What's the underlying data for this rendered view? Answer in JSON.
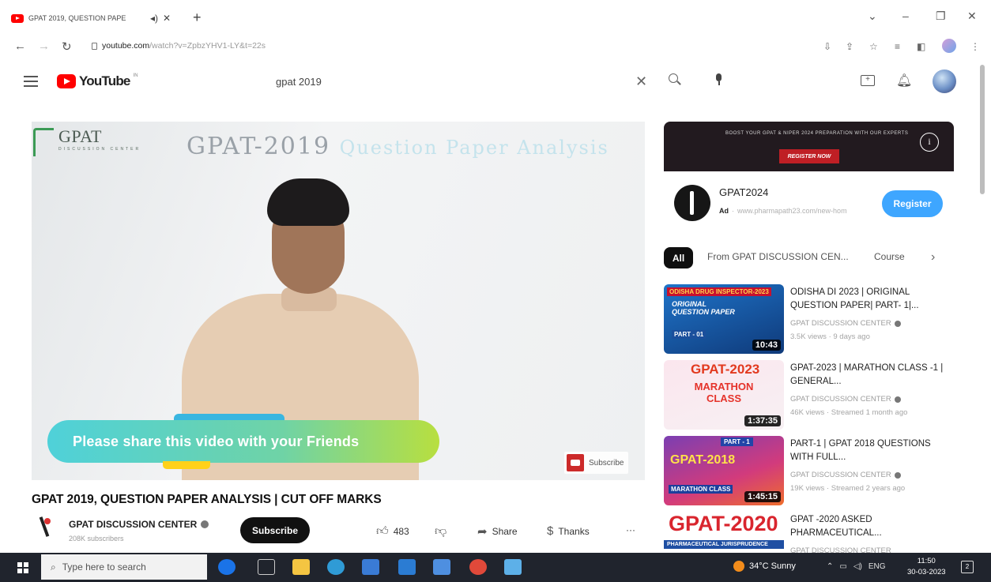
{
  "browser": {
    "tab_title": "GPAT 2019, QUESTION PAPE",
    "url_host": "youtube.com",
    "url_path": "/watch?v=ZpbzYHV1-LY&t=22s"
  },
  "masthead": {
    "logo_text": "YouTube",
    "country_code": "IN",
    "search_value": "gpat 2019"
  },
  "player": {
    "watermark_title": "GPAT",
    "watermark_sub": "DISCUSSION CENTER",
    "board_text": "GPAT-2019",
    "board_text_faint": "Question Paper Analysis",
    "banner_text": "Please share this video with your Friends",
    "subscribe_overlay": "Subscribe"
  },
  "video": {
    "title": "GPAT 2019, QUESTION PAPER ANALYSIS | CUT OFF MARKS",
    "channel_name": "GPAT DISCUSSION CENTER",
    "subscribers": "208K subscribers",
    "subscribe_label": "Subscribe",
    "likes": "483",
    "share_label": "Share",
    "thanks_label": "Thanks",
    "more_label": "···"
  },
  "ad": {
    "banner_top": "BOOST YOUR GPAT & NIPER 2024 PREPARATION WITH OUR EXPERTS",
    "banner_cta": "REGISTER NOW",
    "advertiser": "GPAT2024",
    "ad_tag": "Ad",
    "ad_url": "www.pharmapath23.com/new-hom",
    "register_label": "Register"
  },
  "chips": {
    "all": "All",
    "from_channel": "From GPAT DISCUSSION CEN...",
    "courses": "Course"
  },
  "recommendations": [
    {
      "title": "ODISHA DI 2023 | ORIGINAL QUESTION PAPER| PART- 1|...",
      "channel": "GPAT DISCUSSION CENTER",
      "meta": "3.5K views · 9 days ago",
      "duration": "10:43",
      "thumb_text": "ODISHA DRUG INSPECTOR-2023",
      "thumb_sub": "ORIGINAL QUESTION PAPER",
      "thumb_part": "PART - 01"
    },
    {
      "title": "GPAT-2023 | MARATHON CLASS -1 | GENERAL...",
      "channel": "GPAT DISCUSSION CENTER",
      "meta": "46K views · Streamed 1 month ago",
      "duration": "1:37:35",
      "thumb_text": "GPAT-2023",
      "thumb_sub": "MARATHON CLASS"
    },
    {
      "title": "PART-1 | GPAT 2018 QUESTIONS WITH FULL...",
      "channel": "GPAT DISCUSSION CENTER",
      "meta": "19K views · Streamed 2 years ago",
      "duration": "1:45:15",
      "thumb_text": "GPAT-2018",
      "thumb_sub": "MARATHON CLASS",
      "thumb_part": "PART - 1"
    },
    {
      "title": "GPAT -2020 ASKED PHARMACEUTICAL...",
      "channel": "GPAT DISCUSSION CENTER",
      "meta": "",
      "duration": "",
      "thumb_text": "GPAT-2020",
      "thumb_sub": "PHARMACEUTICAL JURISPRUDENCE"
    }
  ],
  "taskbar": {
    "search_placeholder": "Type here to search",
    "weather": "34°C  Sunny",
    "lang": "ENG",
    "time": "11:50",
    "date": "30-03-2023",
    "notif_count": "2"
  }
}
